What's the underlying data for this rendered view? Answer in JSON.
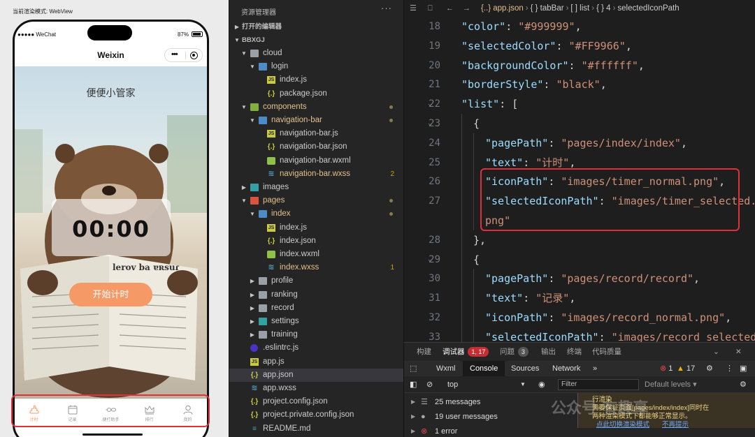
{
  "simulator": {
    "mode_label": "当前渲染模式: WebView",
    "carrier": "●●●●● WeChat",
    "battery": "87%",
    "nav_title": "Weixin",
    "capsule_dots": "•••",
    "page_title": "便便小管家",
    "timer": "00:00",
    "start_button": "开始计时",
    "newspaper_headline": "lerov ba ɐʀsuɾ",
    "tabs": [
      {
        "label": "计时",
        "icon": "poop-icon",
        "active": true
      },
      {
        "label": "记录",
        "icon": "calendar-icon",
        "active": false
      },
      {
        "label": "便打助手",
        "icon": "assistant-icon",
        "active": false
      },
      {
        "label": "排行",
        "icon": "crown-icon",
        "active": false
      },
      {
        "label": "我的",
        "icon": "person-icon",
        "active": false
      }
    ],
    "colors": {
      "accent": "#FF9966",
      "button": "#f59a66",
      "highlight": "#e0313a"
    }
  },
  "explorer": {
    "title": "资源管理器",
    "more": "···",
    "open_editors": "打开的编辑器",
    "project": "BBXGJ",
    "tree": [
      {
        "name": "cloud",
        "type": "folder",
        "color": "gray",
        "depth": 1,
        "open": true
      },
      {
        "name": "login",
        "type": "folder",
        "color": "blue",
        "depth": 2,
        "open": true
      },
      {
        "name": "index.js",
        "type": "js",
        "depth": 3
      },
      {
        "name": "package.json",
        "type": "json",
        "depth": 3
      },
      {
        "name": "components",
        "type": "folder",
        "color": "green",
        "depth": 1,
        "open": true,
        "modified": true,
        "dot": true
      },
      {
        "name": "navigation-bar",
        "type": "folder",
        "color": "blue",
        "depth": 2,
        "open": true,
        "modified": true,
        "dot": true
      },
      {
        "name": "navigation-bar.js",
        "type": "js",
        "depth": 3
      },
      {
        "name": "navigation-bar.json",
        "type": "json",
        "depth": 3
      },
      {
        "name": "navigation-bar.wxml",
        "type": "wxml",
        "depth": 3
      },
      {
        "name": "navigation-bar.wxss",
        "type": "wxss",
        "depth": 3,
        "modified": true,
        "count": "2"
      },
      {
        "name": "images",
        "type": "folder",
        "color": "teal",
        "depth": 1,
        "open": false
      },
      {
        "name": "pages",
        "type": "folder",
        "color": "red",
        "depth": 1,
        "open": true,
        "modified": true,
        "dot": true
      },
      {
        "name": "index",
        "type": "folder",
        "color": "blue",
        "depth": 2,
        "open": true,
        "modified": true,
        "dot": true
      },
      {
        "name": "index.js",
        "type": "js",
        "depth": 3
      },
      {
        "name": "index.json",
        "type": "json",
        "depth": 3
      },
      {
        "name": "index.wxml",
        "type": "wxml",
        "depth": 3
      },
      {
        "name": "index.wxss",
        "type": "wxss",
        "depth": 3,
        "modified": true,
        "count": "1"
      },
      {
        "name": "profile",
        "type": "folder",
        "color": "gray",
        "depth": 2,
        "open": false
      },
      {
        "name": "ranking",
        "type": "folder",
        "color": "gray",
        "depth": 2,
        "open": false
      },
      {
        "name": "record",
        "type": "folder",
        "color": "gray",
        "depth": 2,
        "open": false
      },
      {
        "name": "settings",
        "type": "folder",
        "color": "teal",
        "depth": 2,
        "open": false
      },
      {
        "name": "training",
        "type": "folder",
        "color": "gray",
        "depth": 2,
        "open": false
      },
      {
        "name": ".eslintrc.js",
        "type": "eslint",
        "depth": 1
      },
      {
        "name": "app.js",
        "type": "js",
        "depth": 1
      },
      {
        "name": "app.json",
        "type": "json",
        "depth": 1,
        "selected": true
      },
      {
        "name": "app.wxss",
        "type": "wxss",
        "depth": 1
      },
      {
        "name": "project.config.json",
        "type": "json",
        "depth": 1
      },
      {
        "name": "project.private.config.json",
        "type": "json",
        "depth": 1
      },
      {
        "name": "README.md",
        "type": "readme",
        "depth": 1
      }
    ]
  },
  "editor": {
    "breadcrumb": [
      "{..} app.json",
      "{ } tabBar",
      "[ ] list",
      "{ } 4",
      "selectedIconPath"
    ],
    "lines": [
      {
        "n": "18",
        "indent": 2,
        "tokens": [
          [
            "k",
            "\"color\""
          ],
          [
            "p",
            ": "
          ],
          [
            "s",
            "\"#999999\""
          ],
          [
            "p",
            ","
          ]
        ]
      },
      {
        "n": "19",
        "indent": 2,
        "tokens": [
          [
            "k",
            "\"selectedColor\""
          ],
          [
            "p",
            ": "
          ],
          [
            "s",
            "\"#FF9966\""
          ],
          [
            "p",
            ","
          ]
        ]
      },
      {
        "n": "20",
        "indent": 2,
        "tokens": [
          [
            "k",
            "\"backgroundColor\""
          ],
          [
            "p",
            ": "
          ],
          [
            "s",
            "\"#ffffff\""
          ],
          [
            "p",
            ","
          ]
        ]
      },
      {
        "n": "21",
        "indent": 2,
        "tokens": [
          [
            "k",
            "\"borderStyle\""
          ],
          [
            "p",
            ": "
          ],
          [
            "s",
            "\"black\""
          ],
          [
            "p",
            ","
          ]
        ]
      },
      {
        "n": "22",
        "indent": 2,
        "fold": true,
        "tokens": [
          [
            "k",
            "\"list\""
          ],
          [
            "p",
            ": ["
          ]
        ]
      },
      {
        "n": "23",
        "indent": 3,
        "fold": true,
        "tokens": [
          [
            "p",
            "{"
          ]
        ]
      },
      {
        "n": "24",
        "indent": 4,
        "tokens": [
          [
            "k",
            "\"pagePath\""
          ],
          [
            "p",
            ": "
          ],
          [
            "s",
            "\"pages/index/index\""
          ],
          [
            "p",
            ","
          ]
        ]
      },
      {
        "n": "25",
        "indent": 4,
        "tokens": [
          [
            "k",
            "\"text\""
          ],
          [
            "p",
            ": "
          ],
          [
            "s",
            "\"计时\""
          ],
          [
            "p",
            ","
          ]
        ]
      },
      {
        "n": "26",
        "indent": 4,
        "tokens": [
          [
            "k",
            "\"iconPath\""
          ],
          [
            "p",
            ": "
          ],
          [
            "s",
            "\"images/timer_normal.png\""
          ],
          [
            "p",
            ","
          ]
        ]
      },
      {
        "n": "27",
        "indent": 4,
        "tokens": [
          [
            "k",
            "\"selectedIconPath\""
          ],
          [
            "p",
            ": "
          ],
          [
            "s",
            "\"images/timer_selected."
          ]
        ]
      },
      {
        "n": "",
        "indent": 4,
        "tokens": [
          [
            "s",
            "png\""
          ]
        ]
      },
      {
        "n": "28",
        "indent": 3,
        "tokens": [
          [
            "p",
            "},"
          ]
        ]
      },
      {
        "n": "29",
        "indent": 3,
        "fold": true,
        "tokens": [
          [
            "p",
            "{"
          ]
        ]
      },
      {
        "n": "30",
        "indent": 4,
        "tokens": [
          [
            "k",
            "\"pagePath\""
          ],
          [
            "p",
            ": "
          ],
          [
            "s",
            "\"pages/record/record\""
          ],
          [
            "p",
            ","
          ]
        ]
      },
      {
        "n": "31",
        "indent": 4,
        "tokens": [
          [
            "k",
            "\"text\""
          ],
          [
            "p",
            ": "
          ],
          [
            "s",
            "\"记录\""
          ],
          [
            "p",
            ","
          ]
        ]
      },
      {
        "n": "32",
        "indent": 4,
        "tokens": [
          [
            "k",
            "\"iconPath\""
          ],
          [
            "p",
            ": "
          ],
          [
            "s",
            "\"images/record_normal.png\""
          ],
          [
            "p",
            ","
          ]
        ]
      },
      {
        "n": "33",
        "indent": 4,
        "tokens": [
          [
            "k",
            "\"selectedIconPath\""
          ],
          [
            "p",
            ": "
          ],
          [
            "s",
            "\"images/record_selected."
          ]
        ]
      }
    ]
  },
  "panel": {
    "tabs": {
      "build": "构建",
      "debugger": "调试器",
      "debugger_badge": "1, 17",
      "problems": "问题",
      "problems_badge": "3",
      "output": "输出",
      "terminal": "终端",
      "quality": "代码质量"
    },
    "close": "✕",
    "devtools_tabs": [
      "Wxml",
      "Console",
      "Sources",
      "Network",
      "»"
    ],
    "errors": "1",
    "warnings": "17",
    "context": "top",
    "filter_placeholder": "Filter",
    "levels": "Default levels ▾",
    "messages": [
      {
        "text": "25 messages",
        "icon": "list-icon"
      },
      {
        "text": "19 user messages",
        "icon": "user-icon"
      },
      {
        "text": "1 error",
        "icon": "error-icon"
      }
    ],
    "warning_lines": [
      "行渲染",
      "需要保证页面[pages/index/index]同时在",
      "两种渲染模式下都能够正常显示。"
    ],
    "warning_links": [
      "点此切换渲染模式",
      "不再提示"
    ],
    "watermark": "公众号·有趣享"
  }
}
